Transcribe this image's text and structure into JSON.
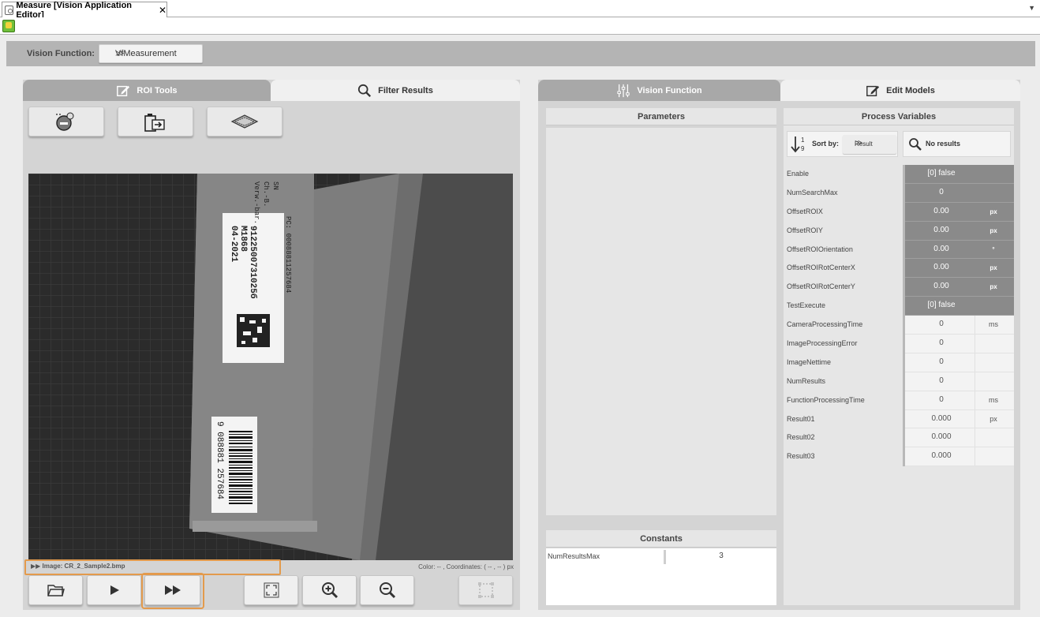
{
  "window": {
    "tab_title": "Measure [Vision Application Editor]",
    "tab_close": "✕",
    "strip_menu": "▼"
  },
  "vision_function": {
    "label": "Vision Function:",
    "selected": "VfMeasurement",
    "dropdown_glyph": "≫"
  },
  "left_panel": {
    "tabs": [
      {
        "label": "ROI Tools",
        "icon": "edit-icon",
        "active": true
      },
      {
        "label": "Filter Results",
        "icon": "search-icon",
        "active": false
      }
    ],
    "tool_buttons": [
      {
        "icon": "roi-subtract-icon"
      },
      {
        "icon": "roi-delete-icon"
      },
      {
        "icon": "roi-layers-icon"
      }
    ],
    "image": {
      "label_sn": "SN",
      "label_ch": "Ch.-B.",
      "label_verw": "Verw.-bar.",
      "label_pc": "PC: 00088811257684",
      "label_line1": "9122500731025б",
      "label_line2": "M1868",
      "label_line3": "04-2021",
      "barcode_text": "9 088881 257684"
    },
    "status": {
      "image_text": "▶▶ Image: CR_2_Sample2.bmp",
      "color_text": "Color:    -- , Coordinates: (     -- ,     -- ) px"
    },
    "bottom_buttons": [
      {
        "icon": "folder-open-icon"
      },
      {
        "icon": "play-icon"
      },
      {
        "icon": "fast-forward-icon"
      },
      {
        "icon": "fit-to-window-icon"
      },
      {
        "icon": "zoom-in-icon"
      },
      {
        "icon": "zoom-out-icon"
      },
      {
        "icon": "roi-selection-icon"
      }
    ]
  },
  "right_panel": {
    "tabs": [
      {
        "label": "Vision Function",
        "icon": "sliders-icon",
        "active": true
      },
      {
        "label": "Edit Models",
        "icon": "edit-icon",
        "active": false
      }
    ],
    "parameters_title": "Parameters",
    "constants_title": "Constants",
    "constants": [
      {
        "name": "NumResultsMax",
        "value": "3"
      }
    ],
    "process_variables_title": "Process Variables",
    "sort_label": "Sort by:",
    "sort_value": "Result",
    "sort_dropdown_glyph": "≫",
    "search_text": "No results",
    "process_variables": [
      {
        "name": "Enable",
        "value": "[0] false",
        "unit": "",
        "style": "dark"
      },
      {
        "name": "NumSearchMax",
        "value": "0",
        "unit": "",
        "style": "dark"
      },
      {
        "name": "OffsetROIX",
        "value": "0.00",
        "unit": "px",
        "style": "dark"
      },
      {
        "name": "OffsetROIY",
        "value": "0.00",
        "unit": "px",
        "style": "dark"
      },
      {
        "name": "OffsetROIOrientation",
        "value": "0.00",
        "unit": "°",
        "style": "dark"
      },
      {
        "name": "OffsetROIRotCenterX",
        "value": "0.00",
        "unit": "px",
        "style": "dark"
      },
      {
        "name": "OffsetROIRotCenterY",
        "value": "0.00",
        "unit": "px",
        "style": "dark"
      },
      {
        "name": "TestExecute",
        "value": "[0] false",
        "unit": "",
        "style": "dark"
      },
      {
        "name": "CameraProcessingTime",
        "value": "0",
        "unit": "ms",
        "style": "light"
      },
      {
        "name": "ImageProcessingError",
        "value": "0",
        "unit": "",
        "style": "light"
      },
      {
        "name": "ImageNettime",
        "value": "0",
        "unit": "",
        "style": "light"
      },
      {
        "name": "NumResults",
        "value": "0",
        "unit": "",
        "style": "light"
      },
      {
        "name": "FunctionProcessingTime",
        "value": "0",
        "unit": "ms",
        "style": "light"
      },
      {
        "name": "Result01",
        "value": "0.000",
        "unit": "px",
        "style": "light"
      },
      {
        "name": "Result02",
        "value": "0.000",
        "unit": "",
        "style": "light"
      },
      {
        "name": "Result03",
        "value": "0.000",
        "unit": "",
        "style": "light"
      }
    ]
  },
  "colors": {
    "highlight": "#e39a4c",
    "active_tab": "#a8a8a8",
    "dark_cell": "#8a8a8a"
  }
}
